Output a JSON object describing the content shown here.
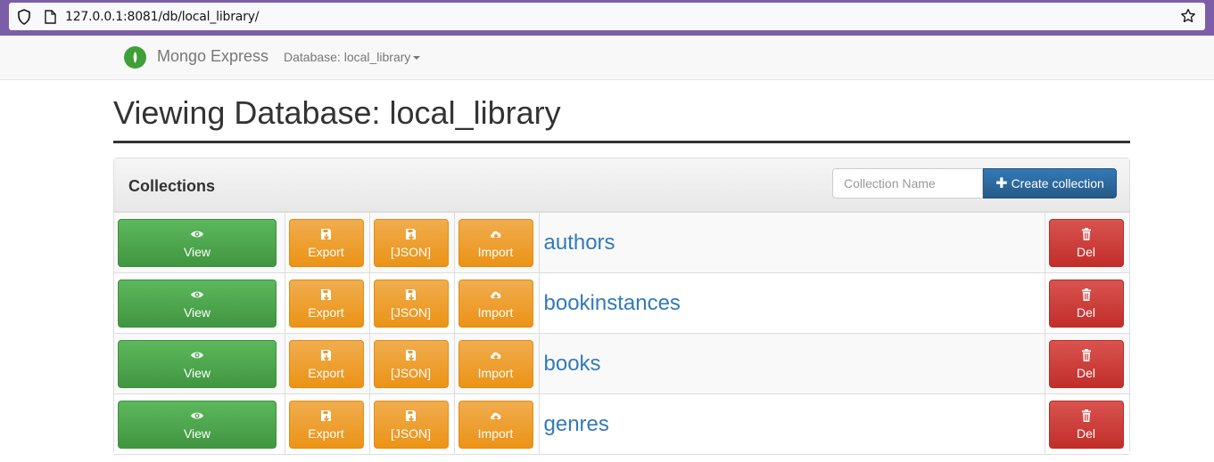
{
  "browser": {
    "url": "127.0.0.1:8081/db/local_library/"
  },
  "navbar": {
    "brand": "Mongo Express",
    "database_menu": "Database: local_library"
  },
  "page": {
    "title": "Viewing Database: local_library"
  },
  "panel": {
    "title": "Collections",
    "input_placeholder": "Collection Name",
    "create_label": "Create collection"
  },
  "buttons": {
    "view": "View",
    "export": "Export",
    "json": "[JSON]",
    "import": "Import",
    "del": "Del"
  },
  "collections": [
    {
      "name": "authors"
    },
    {
      "name": "bookinstances"
    },
    {
      "name": "books"
    },
    {
      "name": "genres"
    }
  ],
  "colors": {
    "view": "#5cb85c",
    "orange": "#f0ad4e",
    "danger": "#d9534f",
    "primary": "#337ab7",
    "browser_accent": "#7b5ea7"
  }
}
